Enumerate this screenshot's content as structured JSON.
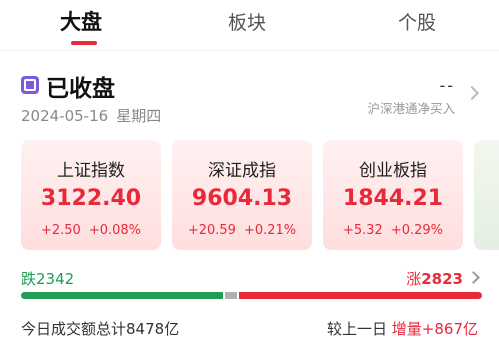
{
  "tabs": [
    {
      "label": "大盘",
      "active": true
    },
    {
      "label": "板块",
      "active": false
    },
    {
      "label": "个股",
      "active": false
    }
  ],
  "status": {
    "title": "已收盘",
    "date": "2024-05-16",
    "weekday": "星期四",
    "icon": "market-closed-icon"
  },
  "northbound": {
    "value": "--",
    "label": "沪深港通净买入"
  },
  "indices": [
    {
      "name": "上证指数",
      "value": "3122.40",
      "change": "+2.50",
      "change_pct": "+0.08%"
    },
    {
      "name": "深证成指",
      "value": "9604.13",
      "change": "+20.59",
      "change_pct": "+0.21%"
    },
    {
      "name": "创业板指",
      "value": "1844.21",
      "change": "+5.32",
      "change_pct": "+0.29%"
    }
  ],
  "breadth": {
    "fall_label": "跌",
    "fall_count": "2342",
    "rise_label": "涨",
    "rise_count": "2823",
    "down_value": 2342,
    "flat_value": 140,
    "up_value": 2823
  },
  "turnover": {
    "label": "今日成交额总计",
    "amount": "8478亿",
    "compare_label": "较上一日",
    "compare_word": "增量",
    "compare_value": "+867亿"
  },
  "colors": {
    "rise": "#e8293a",
    "fall": "#1f9d55",
    "accent": "#e8293a",
    "status_icon": "#7a5cd6"
  }
}
